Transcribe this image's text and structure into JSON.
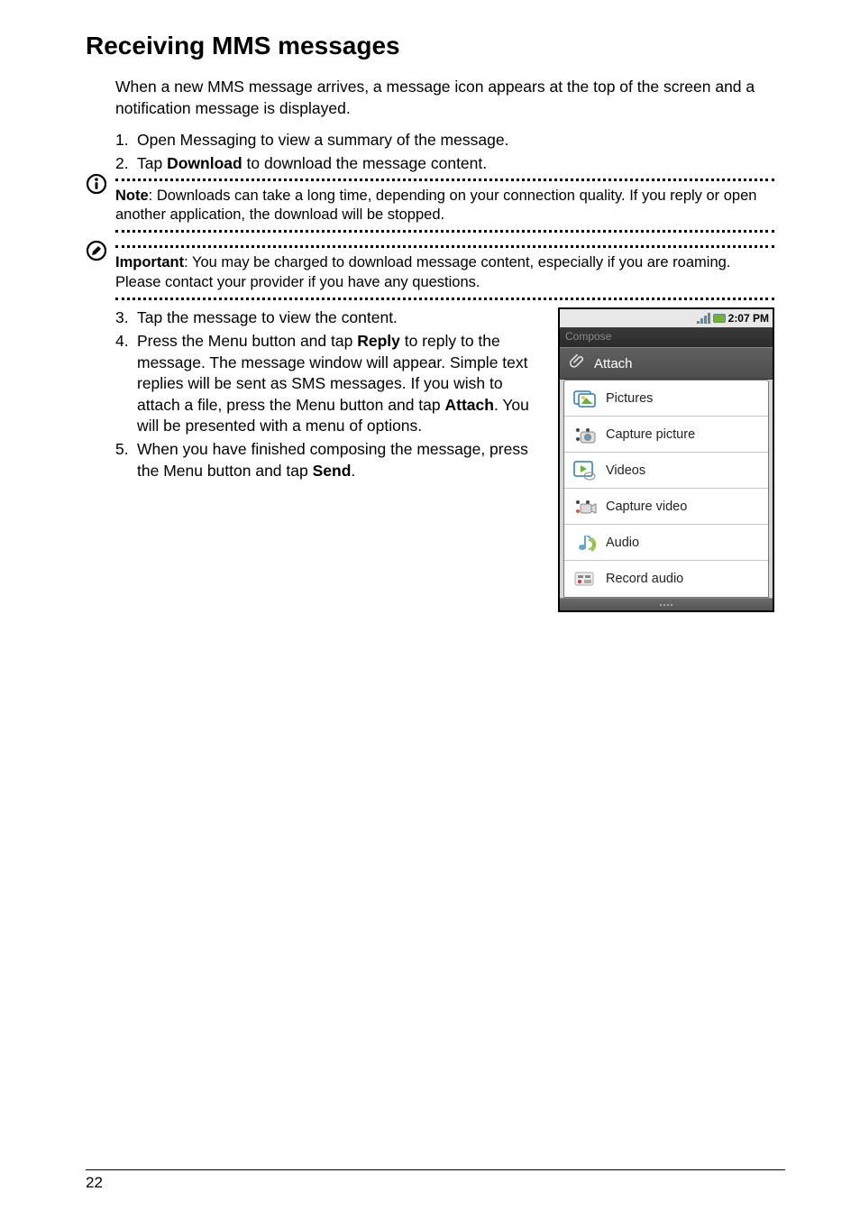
{
  "heading": "Receiving MMS messages",
  "intro": "When a new MMS message arrives, a message icon appears at the top of the screen and a notification message is displayed.",
  "step1": {
    "num": "1.",
    "text": "Open Messaging to view a summary of the message."
  },
  "step2": {
    "num": "2.",
    "pre": "Tap ",
    "bold": "Download",
    "post": " to download the message content."
  },
  "note": {
    "label": "Note",
    "text": ": Downloads can take a long time, depending on your connection quality. If you reply or open another application, the download will be stopped."
  },
  "important": {
    "label": "Important",
    "text": ": You may be charged to download message content, especially if you are roaming. Please contact your provider if you have any questions."
  },
  "step3": {
    "num": "3.",
    "text": "Tap the message to view the content."
  },
  "step4": {
    "num": "4.",
    "pre": "Press the Menu button and tap ",
    "b1": "Reply",
    "mid": " to reply to the message. The message window will appear. Simple text replies will be sent as SMS messages. If you wish to attach a file, press the Menu button and tap ",
    "b2": "Attach",
    "post": ". You will be presented with a menu of options."
  },
  "step5": {
    "num": "5.",
    "pre": "When you have finished composing the message, press the Menu button and tap ",
    "bold": "Send",
    "post": "."
  },
  "phone": {
    "time": "2:07 PM",
    "compose": "Compose",
    "attach": "Attach",
    "items": {
      "pictures": "Pictures",
      "capture_picture": "Capture picture",
      "videos": "Videos",
      "capture_video": "Capture video",
      "audio": "Audio",
      "record_audio": "Record audio"
    }
  },
  "page_number": "22"
}
